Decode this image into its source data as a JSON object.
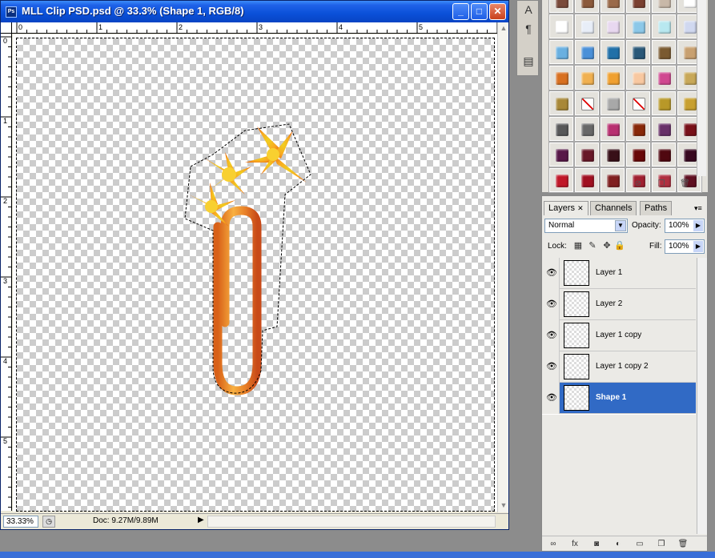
{
  "window": {
    "title": "MLL Clip PSD.psd @ 33.3% (Shape 1, RGB/8)",
    "app_icon_text": "Ps",
    "minimize": "_",
    "maximize": "□",
    "close": "✕"
  },
  "rulers": {
    "top": [
      "0",
      "1",
      "2",
      "3",
      "4",
      "5"
    ],
    "left": [
      "0",
      "1",
      "2",
      "3",
      "4",
      "5"
    ]
  },
  "status": {
    "zoom": "33.33%",
    "doc": "Doc: 9.27M/9.89M",
    "arrow": "▶"
  },
  "tool_panel": {
    "text_tool": "A",
    "paragraph": "¶",
    "notes": "▤"
  },
  "styles_panel": {
    "swatch_colors": [
      [
        "#7a4a3a",
        "#8b5a3c",
        "#9a6a4a",
        "#7a4030",
        "#c8b8a8",
        "#ffffff"
      ],
      [
        "#ffffff",
        "#e8eef8",
        "#e8d8f0",
        "#8cc8e8",
        "#b8e8f0",
        "#d0d8f0"
      ],
      [
        "#6ab0e0",
        "#4a90d8",
        "#2070a8",
        "#2a5878",
        "#7a5a30",
        "#c8a070"
      ],
      [
        "#d87020",
        "#f0b050",
        "#f0a030",
        "#f8c8a0",
        "#d04890",
        "#c8a858"
      ],
      [
        "#a88838",
        "none",
        "#a8a8a8",
        "none",
        "#b89828",
        "#c8a030"
      ],
      [
        "#585858",
        "#686868",
        "#b83070",
        "#882808",
        "#683068",
        "#781018"
      ],
      [
        "#581848",
        "#681828",
        "#381018",
        "#680808",
        "#500810",
        "#380820"
      ],
      [
        "#c01828",
        "#a01020",
        "#802020",
        "#a02030",
        "#b03040",
        "#601020"
      ]
    ]
  },
  "layers_panel": {
    "tabs": [
      "Layers",
      "Channels",
      "Paths"
    ],
    "tab_close": "✕",
    "menu": "▾≡",
    "blend_mode": "Normal",
    "opacity_label": "Opacity:",
    "opacity_value": "100%",
    "lock_label": "Lock:",
    "fill_label": "Fill:",
    "fill_value": "100%",
    "layers": [
      {
        "name": "Layer 1",
        "selected": false
      },
      {
        "name": "Layer 2",
        "selected": false
      },
      {
        "name": "Layer 1 copy",
        "selected": false
      },
      {
        "name": "Layer 1 copy 2",
        "selected": false
      },
      {
        "name": "Shape 1",
        "selected": true
      }
    ],
    "footer_icons": [
      "link-icon",
      "fx-icon",
      "mask-icon",
      "adjustment-icon",
      "folder-icon",
      "new-layer-icon",
      "trash-icon"
    ],
    "footer_glyphs": [
      "∞",
      "fx",
      "◙",
      "◐",
      "▭",
      "❐",
      "🗑"
    ]
  },
  "colors": {
    "titlebar": "#0a50d8",
    "selection": "#316ac5",
    "clip_orange": "#f09030",
    "flower_yellow": "#f8c020"
  }
}
